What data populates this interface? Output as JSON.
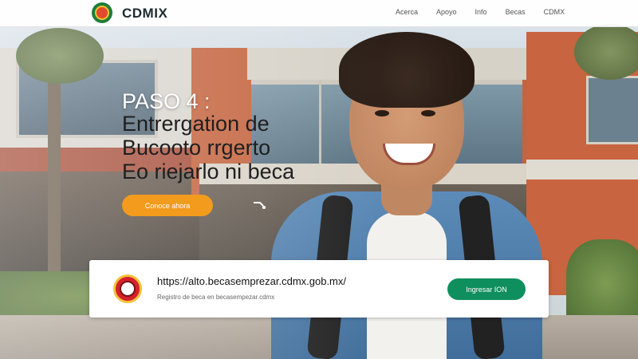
{
  "header": {
    "brand": "CDMIX",
    "nav": [
      "Acerca",
      "Apoyo",
      "Info",
      "Becas",
      "CDMX"
    ]
  },
  "hero": {
    "step": "PASO 4 :",
    "headline_lines": [
      "Entrergation de",
      "Bucooto rrgerto",
      "Eo riejarlo ni beca"
    ],
    "cta_label": "Conoce ahora"
  },
  "card": {
    "url": "https://alto.becasemprezar.cdmx.gob.mx/",
    "subtext": "Registro de beca en becasempezar.cdmx",
    "button_label": "Ingresar ION"
  },
  "colors": {
    "accent_orange": "#f29b1d",
    "accent_green": "#0f8f5d",
    "brand_green": "#1e7d3a"
  }
}
